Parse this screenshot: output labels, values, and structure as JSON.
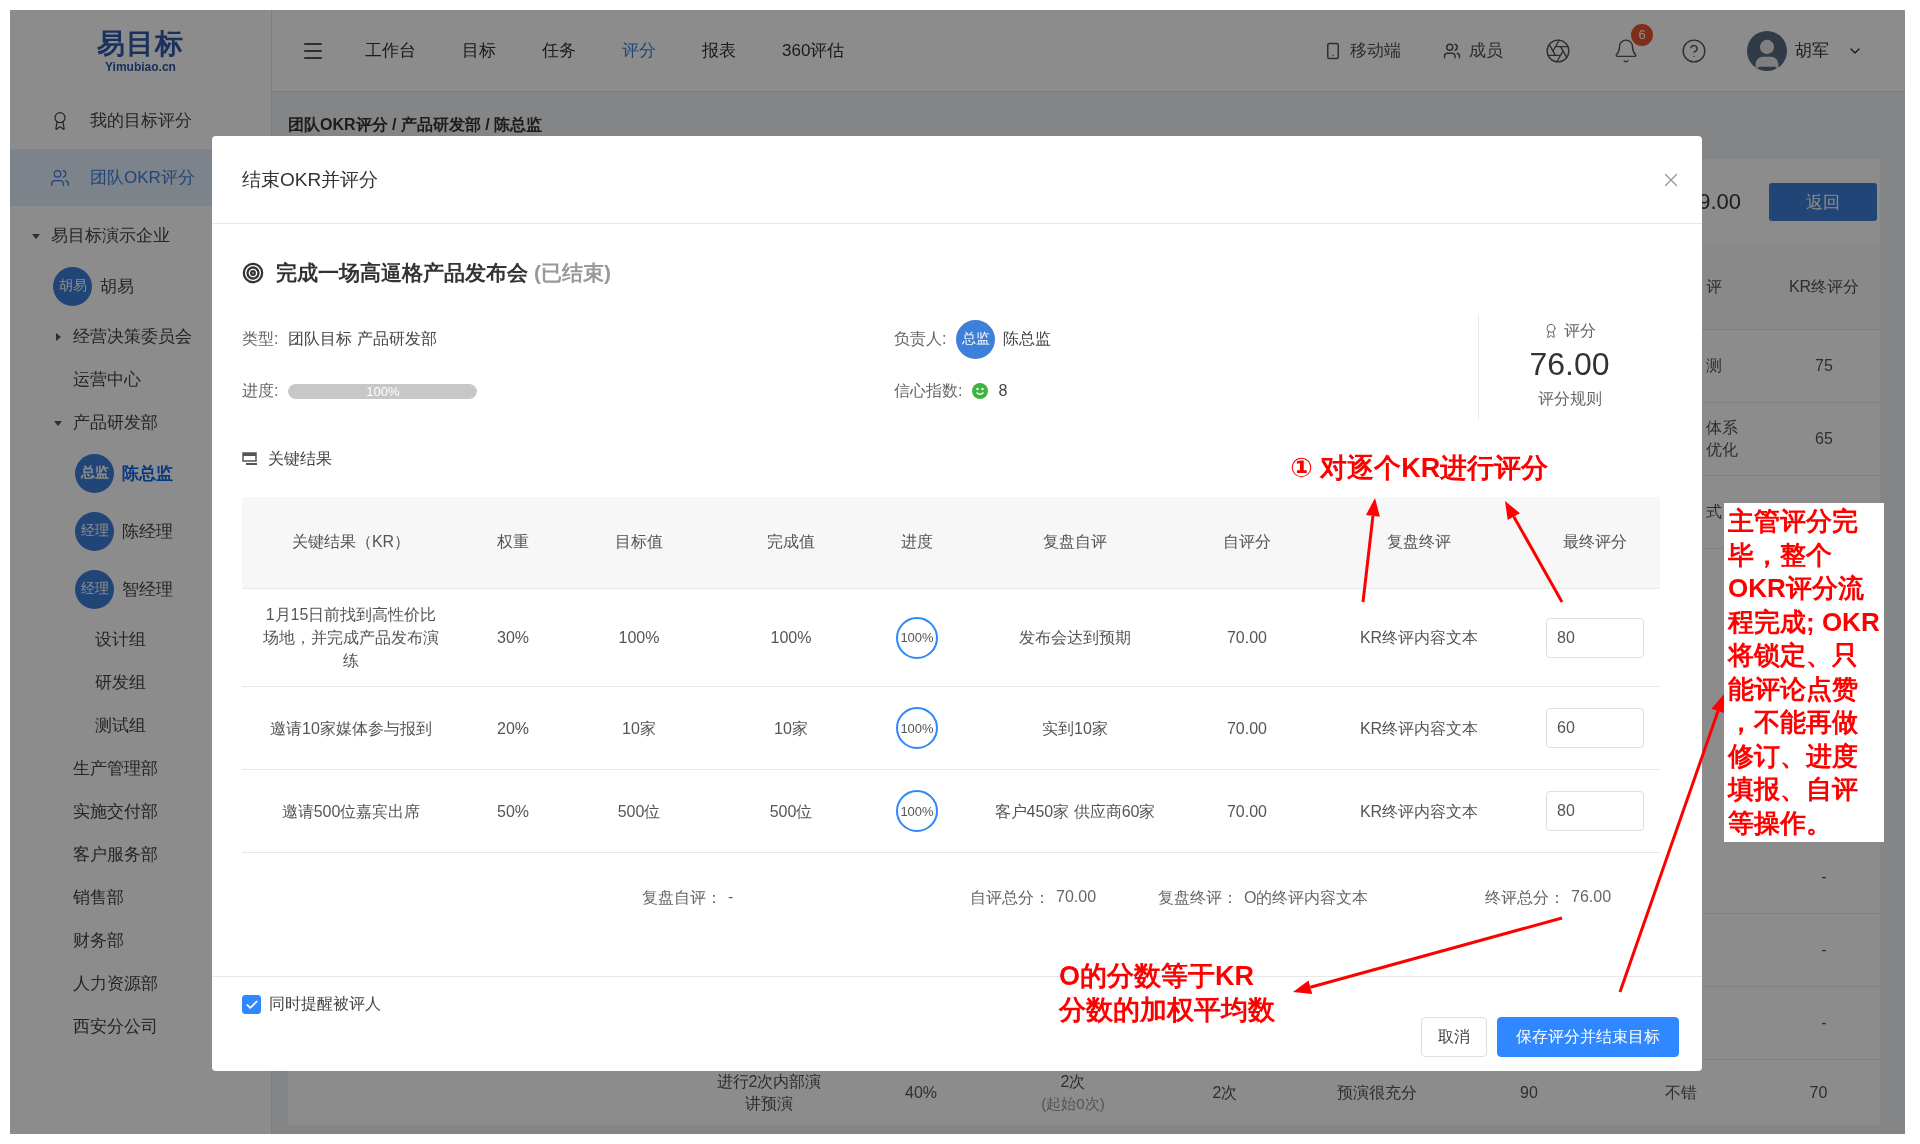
{
  "sidebar": {
    "logo": {
      "name": "易目标",
      "domain": "Yimubiao.cn"
    },
    "menu": [
      {
        "kind": "mine",
        "label": "我的目标评分",
        "selected": false
      },
      {
        "kind": "team",
        "label": "团队OKR评分",
        "selected": true
      }
    ],
    "tree": [
      {
        "kind": "dept",
        "label": "易目标演示企业",
        "selected": false,
        "expanded": true,
        "children": [
          {
            "kind": "person",
            "avatar": "胡易",
            "label": "胡易",
            "selected": false
          },
          {
            "kind": "dept",
            "label": "经营决策委员会",
            "selected": false,
            "expanded": false
          },
          {
            "kind": "dept",
            "label": "运营中心",
            "selected": false
          },
          {
            "kind": "dept",
            "label": "产品研发部",
            "selected": false,
            "expanded": true,
            "children": [
              {
                "kind": "person",
                "avatar": "总监",
                "label": "陈总监",
                "selected": true
              },
              {
                "kind": "person",
                "avatar": "经理",
                "label": "陈经理",
                "selected": false
              },
              {
                "kind": "person",
                "avatar": "经理",
                "label": "智经理",
                "selected": false
              },
              {
                "kind": "dept",
                "label": "设计组",
                "selected": false
              },
              {
                "kind": "dept",
                "label": "研发组",
                "selected": false
              },
              {
                "kind": "dept",
                "label": "测试组",
                "selected": false
              }
            ]
          },
          {
            "kind": "dept",
            "label": "生产管理部",
            "selected": false
          },
          {
            "kind": "dept",
            "label": "实施交付部",
            "selected": false
          },
          {
            "kind": "dept",
            "label": "客户服务部",
            "selected": false
          },
          {
            "kind": "dept",
            "label": "销售部",
            "selected": false
          },
          {
            "kind": "dept",
            "label": "财务部",
            "selected": false
          },
          {
            "kind": "dept",
            "label": "人力资源部",
            "selected": false
          },
          {
            "kind": "dept",
            "label": "西安分公司",
            "selected": false
          }
        ]
      }
    ]
  },
  "topbar": {
    "nav": [
      {
        "label": "工作台",
        "selected": false
      },
      {
        "label": "目标",
        "selected": false
      },
      {
        "label": "任务",
        "selected": false
      },
      {
        "label": "评分",
        "selected": true
      },
      {
        "label": "报表",
        "selected": false
      },
      {
        "label": "360评估",
        "selected": false
      }
    ],
    "tools": [
      {
        "kind": "mobile",
        "label": "移动端"
      },
      {
        "kind": "members",
        "label": "成员"
      },
      {
        "kind": "aperture"
      },
      {
        "kind": "bell",
        "badge": "6"
      },
      {
        "kind": "help"
      }
    ],
    "user": {
      "name": "胡军"
    }
  },
  "main": {
    "breadcrumb": "团队OKR评分 / 产品研发部 / 陈总监",
    "score": "9.00",
    "back": "返回",
    "columns": [
      "评",
      "KR终评分"
    ],
    "rows_top": [
      {
        "review": "测",
        "score": "75"
      },
      {
        "review": "体系优化",
        "score": "65"
      },
      {
        "review": "式"
      }
    ],
    "rows_bottom": [
      {
        "score": "-"
      },
      {
        "score": "-"
      },
      {
        "score": "-"
      }
    ],
    "last_row": {
      "kr": "进行2次内部演讲预演",
      "weight": "40%",
      "target": "2次",
      "target_note": "(起始0次)",
      "actual": "2次",
      "review": "预演很充分",
      "self_score": "90",
      "final_review": "不错",
      "final_score": "70"
    }
  },
  "modal": {
    "title": "结束OKR并评分",
    "objective": {
      "title": "完成一场高逼格产品发布会",
      "status": "(已结束)"
    },
    "info": {
      "type_label": "类型:",
      "type": "团队目标 产品研发部",
      "progress_label": "进度:",
      "progress": "100%",
      "level": 1,
      "owner_label": "负责人:",
      "owner_avatar": "总监",
      "owner": "陈总监",
      "confidence_label": "信心指数:",
      "confidence": "8"
    },
    "score": {
      "label": "评分",
      "value": "76.00",
      "rule": "评分规则"
    },
    "section": "关键结果",
    "columns": [
      "关键结果（KR）",
      "权重",
      "目标值",
      "完成值",
      "进度",
      "复盘自评",
      "自评分",
      "复盘终评",
      "最终评分"
    ],
    "rows": [
      {
        "kr": "1月15日前找到高性价比场地，并完成产品发布演练",
        "weight": "30%",
        "target": "100%",
        "actual": "100%",
        "progress": "100%",
        "level": 1,
        "self_review": "发布会达到预期",
        "self_score": "70.00",
        "final_review": "KR终评内容文本",
        "final_score": "80"
      },
      {
        "kr": "邀请10家媒体参与报到",
        "weight": "20%",
        "target": "10家",
        "actual": "10家",
        "progress": "100%",
        "level": 1,
        "self_review": "实到10家",
        "self_score": "70.00",
        "final_review": "KR终评内容文本",
        "final_score": "60"
      },
      {
        "kr": "邀请500位嘉宾出席",
        "weight": "50%",
        "target": "500位",
        "actual": "500位",
        "progress": "100%",
        "level": 1,
        "self_review": "客户450家 供应商60家",
        "self_score": "70.00",
        "final_review": "KR终评内容文本",
        "final_score": "80"
      }
    ],
    "summary": [
      {
        "label": "复盘自评：",
        "value": "-"
      },
      {
        "label": "自评总分：",
        "value": "70.00"
      },
      {
        "label": "复盘终评：",
        "value": "O的终评内容文本"
      },
      {
        "label": "终评总分：",
        "value": "76.00"
      }
    ],
    "remind": {
      "label": "同时提醒被评人",
      "checked": true
    },
    "buttons": [
      {
        "kind": "secondary",
        "label": "取消"
      },
      {
        "kind": "primary",
        "label": "保存评分并结束目标"
      }
    ]
  },
  "annotations": {
    "kr_note": "① 对逐个KR进行评分",
    "o_note": [
      "O的分数等于KR",
      "分数的加权平均数"
    ],
    "lock_note": [
      "主管评分完",
      "毕，整个",
      "OKR评分流",
      "程完成; OKR",
      "将锁定、只",
      "能评论点赞",
      "，不能再做",
      "修订、进度",
      "填报、自评",
      "等操作。"
    ]
  }
}
